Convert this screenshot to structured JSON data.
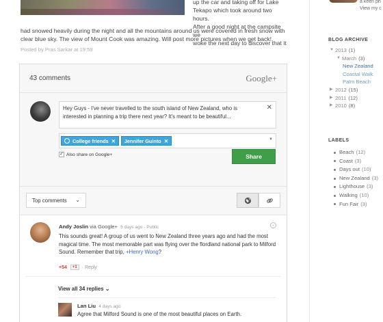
{
  "post": {
    "text_right_lines": [
      "up the car and taking off for Lake",
      "Tekapo which took around two hours.",
      "After a good night at the campsite we",
      "woke the next day to discover that it"
    ],
    "text_full_lines": [
      "had snowed heavily during the night and all the mountains around us were covered in fresh snow with",
      "clear blue sky. The view of Mount Cook was amazing. Will post more pictures when we get back!."
    ],
    "posted_by": "Posted by Pras Sarkar at 19:59"
  },
  "widget": {
    "comment_count": "43 comments",
    "logo": "Google+",
    "compose": {
      "text": "Hey Guys - I've never travelled to the south island of New Zealand, who is interested in planning a trip there next year? It's meant to be beautiful...",
      "close": "✕",
      "chips": [
        {
          "label": "College friends",
          "x": "✕"
        },
        {
          "label": "Jennifer Guinto",
          "x": "✕"
        }
      ],
      "also_share": "Also share on Google+",
      "share_button": "Share"
    },
    "sort": {
      "selected": "Top comments",
      "chevron": "⌄",
      "globe": "🌐",
      "link": "⛓"
    },
    "comment": {
      "author": "Andy Joslin",
      "via": "via Google+",
      "meta": "5 days ago  -  Public",
      "body_before": "This sounds great! A group of us went to New Zealand three years ago and had the most magical time. The most memorable part was flying over the flordland national park to Milford Sound. Remember that trip, ",
      "mention": "+Henry Wong",
      "body_after": "?",
      "plus_count": "+54",
      "plus_one": "+1",
      "reply": "Reply",
      "menu": "⌄"
    },
    "view_replies": "View all 34 replies  ⌄",
    "reply": {
      "author": "Lan Liu",
      "meta": "4 days ago",
      "body": "Agree that Milford Sound is one of the most beautiful places on Earth."
    }
  },
  "sidebar": {
    "profile_lines": [
      "a keen ph",
      "View my c"
    ],
    "archive_heading": "BLOG ARCHIVE",
    "archive": [
      {
        "arrow": "▼",
        "label": "2013",
        "count": "(1)",
        "level": 0
      },
      {
        "arrow": "▼",
        "label": "March",
        "count": "(3)",
        "level": 1
      },
      {
        "arrow": "",
        "label": "New Zealand",
        "count": "",
        "level": 2,
        "active": true
      },
      {
        "arrow": "",
        "label": "Coastal Walk",
        "count": "",
        "level": 2
      },
      {
        "arrow": "",
        "label": "Palm Beach",
        "count": "",
        "level": 2
      },
      {
        "arrow": "▶",
        "label": "2012",
        "count": "(15)",
        "level": 0
      },
      {
        "arrow": "▶",
        "label": "2011",
        "count": "(12)",
        "level": 0
      },
      {
        "arrow": "▶",
        "label": "2010",
        "count": "(8)",
        "level": 0
      }
    ],
    "labels_heading": "LABELS",
    "labels": [
      {
        "name": "Beach",
        "count": "(12)"
      },
      {
        "name": "Coast",
        "count": "(3)"
      },
      {
        "name": "Days out",
        "count": "(10)"
      },
      {
        "name": "New Zealand",
        "count": "(3)"
      },
      {
        "name": "Lighthouse",
        "count": "(3)"
      },
      {
        "name": "Walking",
        "count": "(10)"
      },
      {
        "name": "Fun Fair",
        "count": "(3)"
      }
    ]
  }
}
